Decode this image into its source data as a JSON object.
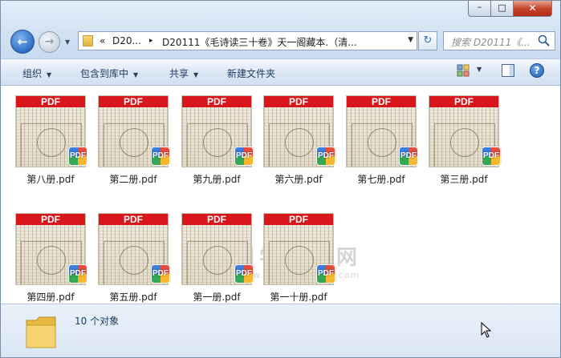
{
  "window": {
    "min_symbol": "–",
    "max_symbol": "□",
    "close_symbol": "✕"
  },
  "nav": {
    "back_symbol": "←",
    "forward_symbol": "→",
    "dropdown_symbol": "▼"
  },
  "address": {
    "overflow": "«",
    "segment1": "D20...",
    "separator": "▸",
    "segment2": "D20111《毛诗读三十卷》天一阁藏本.（清...",
    "dropdown_symbol": "▼"
  },
  "refresh_symbol": "↻",
  "search": {
    "placeholder": "搜索 D20111《..."
  },
  "toolbar": {
    "organize": "组织",
    "include_in_library": "包含到库中",
    "share": "共享",
    "new_folder": "新建文件夹",
    "arrow": "▼",
    "help_symbol": "?"
  },
  "files": [
    {
      "name": "第八册.pdf",
      "band": "PDF",
      "badge": "PDF"
    },
    {
      "name": "第二册.pdf",
      "band": "PDF",
      "badge": "PDF"
    },
    {
      "name": "第九册.pdf",
      "band": "PDF",
      "badge": "PDF"
    },
    {
      "name": "第六册.pdf",
      "band": "PDF",
      "badge": "PDF"
    },
    {
      "name": "第七册.pdf",
      "band": "PDF",
      "badge": "PDF"
    },
    {
      "name": "第三册.pdf",
      "band": "PDF",
      "badge": "PDF"
    },
    {
      "name": "第四册.pdf",
      "band": "PDF",
      "badge": "PDF"
    },
    {
      "name": "第五册.pdf",
      "band": "PDF",
      "badge": "PDF"
    },
    {
      "name": "第一册.pdf",
      "band": "PDF",
      "badge": "PDF"
    },
    {
      "name": "第一十册.pdf",
      "band": "PDF",
      "badge": "PDF"
    }
  ],
  "watermark": {
    "seal": "國",
    "title": "国学资源网",
    "url": "www.guoxueziyuan.com"
  },
  "status": {
    "count": "10 个对象"
  },
  "colors": {
    "pdf_red": "#d8161c",
    "chrome_blue": "#d3e2f3"
  }
}
